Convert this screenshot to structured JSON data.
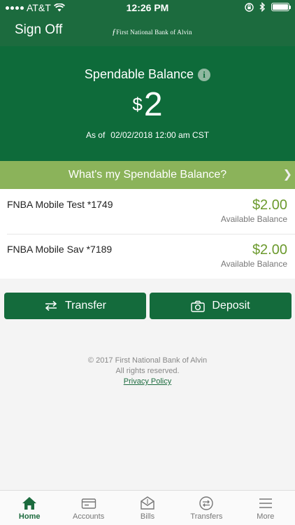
{
  "status_bar": {
    "carrier": "AT&T",
    "time": "12:26 PM"
  },
  "nav": {
    "sign_off": "Sign Off",
    "logo_text": "First National Bank of Alvin"
  },
  "hero": {
    "title": "Spendable Balance",
    "currency": "$",
    "amount": "2",
    "as_of_label": "As of",
    "as_of_date": "02/02/2018 12:00 am CST"
  },
  "whats_bar": {
    "label": "What's my Spendable Balance?"
  },
  "accounts": [
    {
      "name": "FNBA Mobile Test *1749",
      "balance": "$2.00",
      "balance_label": "Available Balance"
    },
    {
      "name": "FNBA Mobile Sav *7189",
      "balance": "$2.00",
      "balance_label": "Available Balance"
    }
  ],
  "actions": {
    "transfer": "Transfer",
    "deposit": "Deposit"
  },
  "footer": {
    "copyright": "© 2017 First National Bank of Alvin",
    "rights": "All rights reserved.",
    "privacy": "Privacy Policy"
  },
  "tabs": [
    {
      "label": "Home",
      "icon": "home-icon",
      "active": true
    },
    {
      "label": "Accounts",
      "icon": "accounts-icon",
      "active": false
    },
    {
      "label": "Bills",
      "icon": "bills-icon",
      "active": false
    },
    {
      "label": "Transfers",
      "icon": "transfers-icon",
      "active": false
    },
    {
      "label": "More",
      "icon": "menu-icon",
      "active": false
    }
  ],
  "colors": {
    "brand_green": "#1c6b3e",
    "hero_green": "#0e6b3a",
    "accent_green": "#8bb35a",
    "balance_green": "#6c9a2e"
  }
}
